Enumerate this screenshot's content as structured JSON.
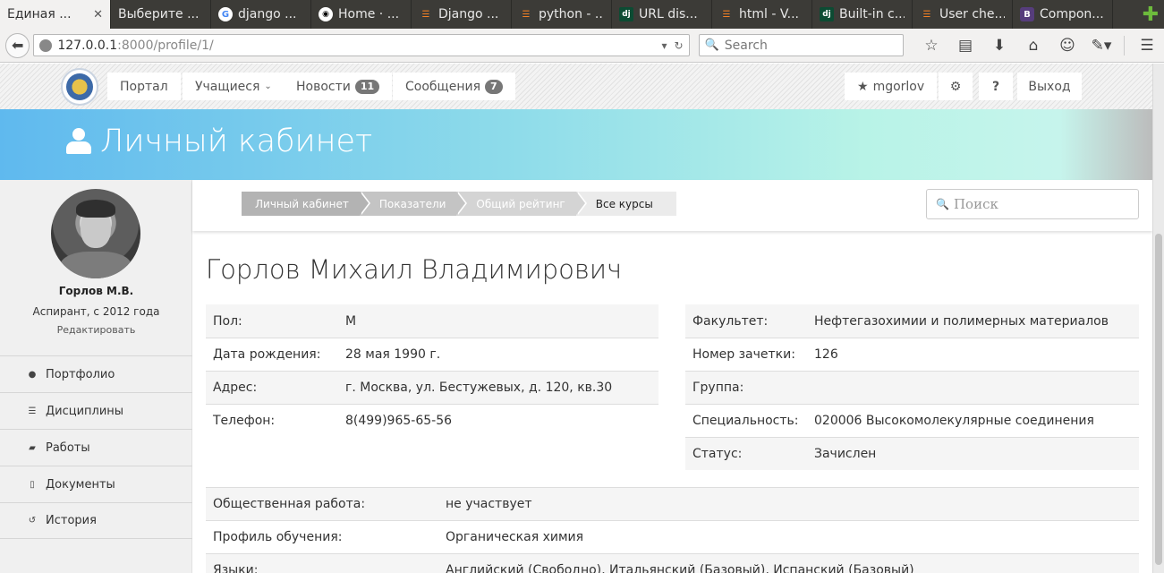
{
  "browser": {
    "tabs": [
      {
        "title": "Единая ...",
        "icon": "none",
        "active": true
      },
      {
        "title": "Выберите ...",
        "icon": "none"
      },
      {
        "title": "django ...",
        "icon": "google"
      },
      {
        "title": "Home · ...",
        "icon": "github"
      },
      {
        "title": "Django ...",
        "icon": "stackoverflow"
      },
      {
        "title": "python - ...",
        "icon": "stackoverflow"
      },
      {
        "title": "URL dis...",
        "icon": "django"
      },
      {
        "title": "html - V...",
        "icon": "stackoverflow"
      },
      {
        "title": "Built-in c...",
        "icon": "django"
      },
      {
        "title": "User che...",
        "icon": "stackoverflow"
      },
      {
        "title": "Compon...",
        "icon": "bootstrap"
      }
    ],
    "url_host": "127.0.0.1",
    "url_path": ":8000/profile/1/",
    "search_placeholder": "Search"
  },
  "site": {
    "nav": {
      "portal": "Портал",
      "students": "Учащиеся",
      "news": "Новости",
      "news_count": "11",
      "messages": "Сообщения",
      "messages_count": "7",
      "user": "mgorlov",
      "help": "?",
      "logout": "Выход"
    },
    "hero_title": "Личный кабинет"
  },
  "sidebar": {
    "name": "Горлов М.В.",
    "status": "Аспирант, с 2012 года",
    "edit": "Редактировать",
    "menu": [
      {
        "label": "Портфолио",
        "icon": "user-icon"
      },
      {
        "label": "Дисциплины",
        "icon": "list-icon"
      },
      {
        "label": "Работы",
        "icon": "book-icon"
      },
      {
        "label": "Документы",
        "icon": "file-icon"
      },
      {
        "label": "История",
        "icon": "history-icon"
      }
    ]
  },
  "breadcrumbs": [
    "Личный кабинет",
    "Показатели",
    "Общий рейтинг",
    "Все курсы"
  ],
  "page_search_placeholder": "Поиск",
  "profile": {
    "full_name": "Горлов Михаил Владимирович",
    "left": [
      {
        "k": "Пол:",
        "v": "М"
      },
      {
        "k": "Дата рождения:",
        "v": "28 мая 1990 г."
      },
      {
        "k": "Адрес:",
        "v": "г. Москва, ул. Бестужевых, д. 120, кв.30"
      },
      {
        "k": "Телефон:",
        "v": "8(499)965-65-56"
      }
    ],
    "right": [
      {
        "k": "Факультет:",
        "v": "Нефтегазохимии и полимерных материалов"
      },
      {
        "k": "Номер зачетки:",
        "v": "126"
      },
      {
        "k": "Группа:",
        "v": ""
      },
      {
        "k": "Специальность:",
        "v": "020006 Высокомолекулярные соединения"
      },
      {
        "k": "Статус:",
        "v": "Зачислен"
      }
    ],
    "bottom": [
      {
        "k": "Общественная работа:",
        "v": "не участвует"
      },
      {
        "k": "Профиль обучения:",
        "v": "Органическая химия"
      },
      {
        "k": "Языки:",
        "v": "Английский (Свободно), Итальянский (Базовый), Испанский (Базовый)"
      }
    ]
  }
}
